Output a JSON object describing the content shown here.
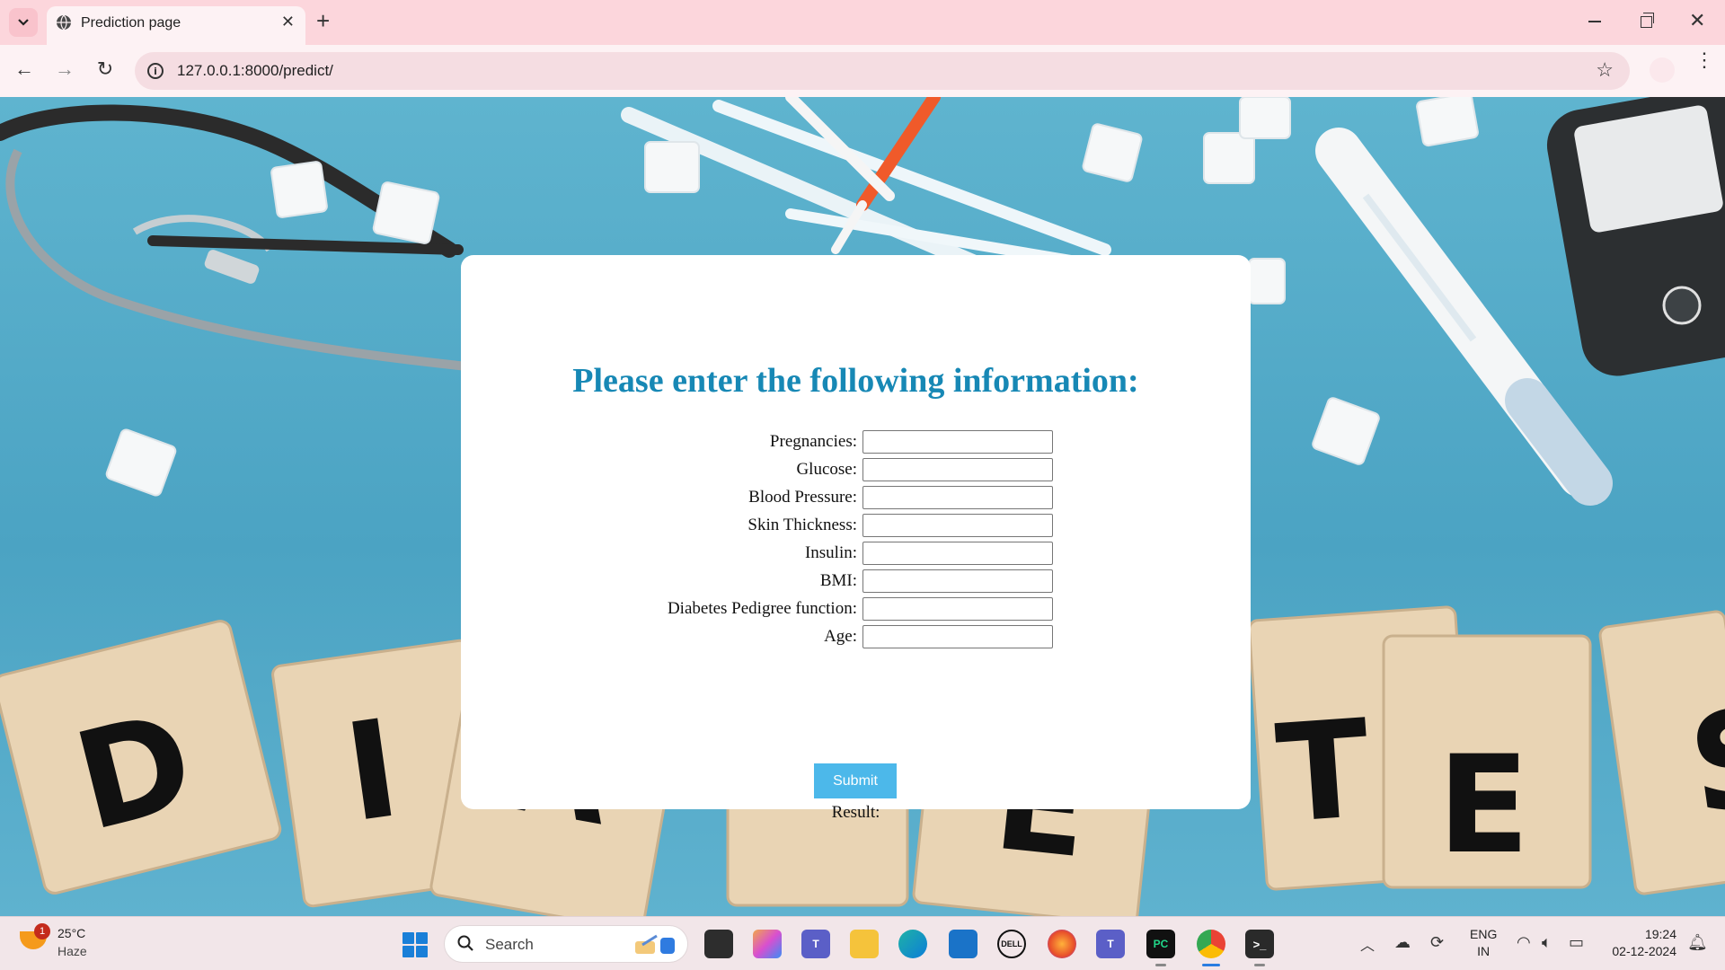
{
  "browser": {
    "tab_title": "Prediction page",
    "url": "127.0.0.1:8000/predict/"
  },
  "form": {
    "heading": "Please enter the following information:",
    "fields": [
      {
        "label": "Pregnancies:",
        "value": ""
      },
      {
        "label": "Glucose:",
        "value": ""
      },
      {
        "label": "Blood Pressure:",
        "value": ""
      },
      {
        "label": "Skin Thickness:",
        "value": ""
      },
      {
        "label": "Insulin:",
        "value": ""
      },
      {
        "label": "BMI:",
        "value": ""
      },
      {
        "label": "Diabetes Pedigree function:",
        "value": ""
      },
      {
        "label": "Age:",
        "value": ""
      }
    ],
    "submit_label": "Submit",
    "result_label": "Result:"
  },
  "background": {
    "letters": [
      "D",
      "I",
      "A",
      "E",
      "T",
      "E",
      "S"
    ]
  },
  "taskbar": {
    "weather_temp": "25°C",
    "weather_condition": "Haze",
    "weather_badge": "1",
    "search_placeholder": "Search",
    "language_top": "ENG",
    "language_bottom": "IN",
    "time": "19:24",
    "date": "02-12-2024"
  },
  "colors": {
    "heading": "#1788b5",
    "submit_button": "#4cb8ea",
    "tab_strip": "#fcd6dc",
    "page_background": "#4ba3c3"
  },
  "icons": [
    "globe-icon",
    "close-icon",
    "plus-icon",
    "back-arrow-icon",
    "forward-arrow-icon",
    "reload-icon",
    "info-icon",
    "star-icon",
    "more-vert-icon",
    "windows-start-icon",
    "search-icon",
    "wifi-icon",
    "volume-icon",
    "battery-icon",
    "notification-bell-icon"
  ]
}
